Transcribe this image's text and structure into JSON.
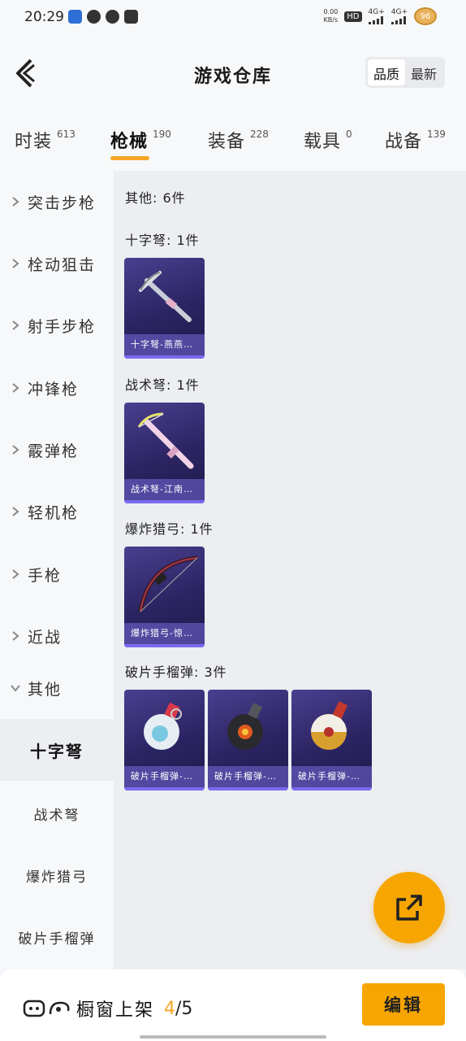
{
  "status_bar": {
    "time": "20:29",
    "net_speed_value": "0.00",
    "net_speed_unit": "KB/s",
    "hd_label": "HD",
    "sim1_label": "4G+",
    "sim2_label": "4G+",
    "battery": "96"
  },
  "header": {
    "title": "游戏仓库",
    "sort_options": [
      "品质",
      "最新"
    ]
  },
  "tabs": [
    {
      "label": "时装",
      "count": "613"
    },
    {
      "label": "枪械",
      "count": "190"
    },
    {
      "label": "装备",
      "count": "228"
    },
    {
      "label": "载具",
      "count": "0"
    },
    {
      "label": "战备",
      "count": "139"
    }
  ],
  "active_tab": "枪械",
  "sidebar": {
    "categories": [
      "突击步枪",
      "栓动狙击",
      "射手步枪",
      "冲锋枪",
      "霰弹枪",
      "轻机枪",
      "手枪",
      "近战",
      "其他"
    ],
    "subcategories": [
      "十字弩",
      "战术弩",
      "爆炸猎弓",
      "破片手榴弹"
    ],
    "selected_sub": "十字弩"
  },
  "content": {
    "summary": "其他: 6件",
    "groups": [
      {
        "title": "十字弩: 1件",
        "items": [
          "十字弩-燕燕…"
        ]
      },
      {
        "title": "战术弩: 1件",
        "items": [
          "战术弩-江南…"
        ]
      },
      {
        "title": "爆炸猎弓: 1件",
        "items": [
          "爆炸猎弓-惊…"
        ]
      },
      {
        "title": "破片手榴弹: 3件",
        "items": [
          "破片手榴弹-…",
          "破片手榴弹-…",
          "破片手榴弹-…"
        ]
      }
    ]
  },
  "bottom_bar": {
    "showcase_label": "橱窗上架",
    "count_current": "4",
    "count_total": "/5",
    "edit_label": "编辑"
  },
  "icons": {
    "back": "back-arrow-icon",
    "share": "share-out-icon",
    "showcase": "showcase-icon"
  },
  "colors": {
    "accent": "#f7a500",
    "card_bg": "#2b2462",
    "count_highlight": "#f5a623"
  }
}
